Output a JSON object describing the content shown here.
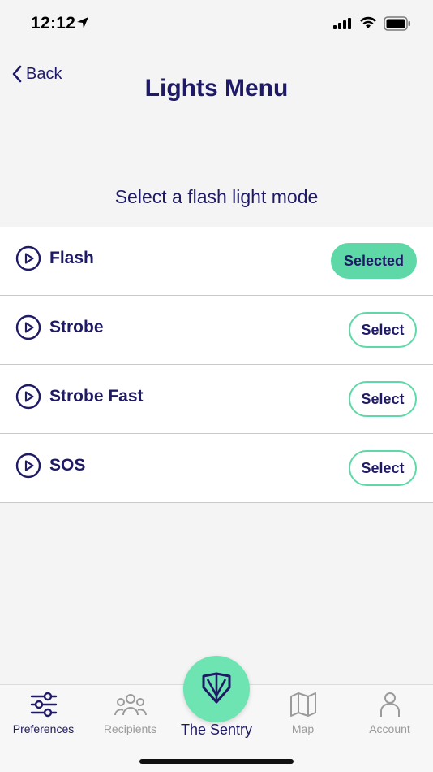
{
  "status_bar": {
    "time": "12:12"
  },
  "nav": {
    "back_label": "Back",
    "title": "Lights Menu"
  },
  "section_title": "Select a flash light mode",
  "modes": [
    {
      "label": "Flash",
      "button": "Selected",
      "selected": true
    },
    {
      "label": "Strobe",
      "button": "Select",
      "selected": false
    },
    {
      "label": "Strobe Fast",
      "button": "Select",
      "selected": false
    },
    {
      "label": "SOS",
      "button": "Select",
      "selected": false
    }
  ],
  "tabs": [
    {
      "label": "Preferences",
      "icon": "sliders-icon",
      "active": true
    },
    {
      "label": "Recipients",
      "icon": "people-icon",
      "active": false
    },
    {
      "label": "The Sentry",
      "icon": "shield-icon",
      "active": false
    },
    {
      "label": "Map",
      "icon": "map-icon",
      "active": false
    },
    {
      "label": "Account",
      "icon": "person-icon",
      "active": false
    }
  ],
  "colors": {
    "brand_navy": "#1f1a66",
    "accent_green": "#5fd8a8",
    "inactive_gray": "#9b9b9b"
  }
}
